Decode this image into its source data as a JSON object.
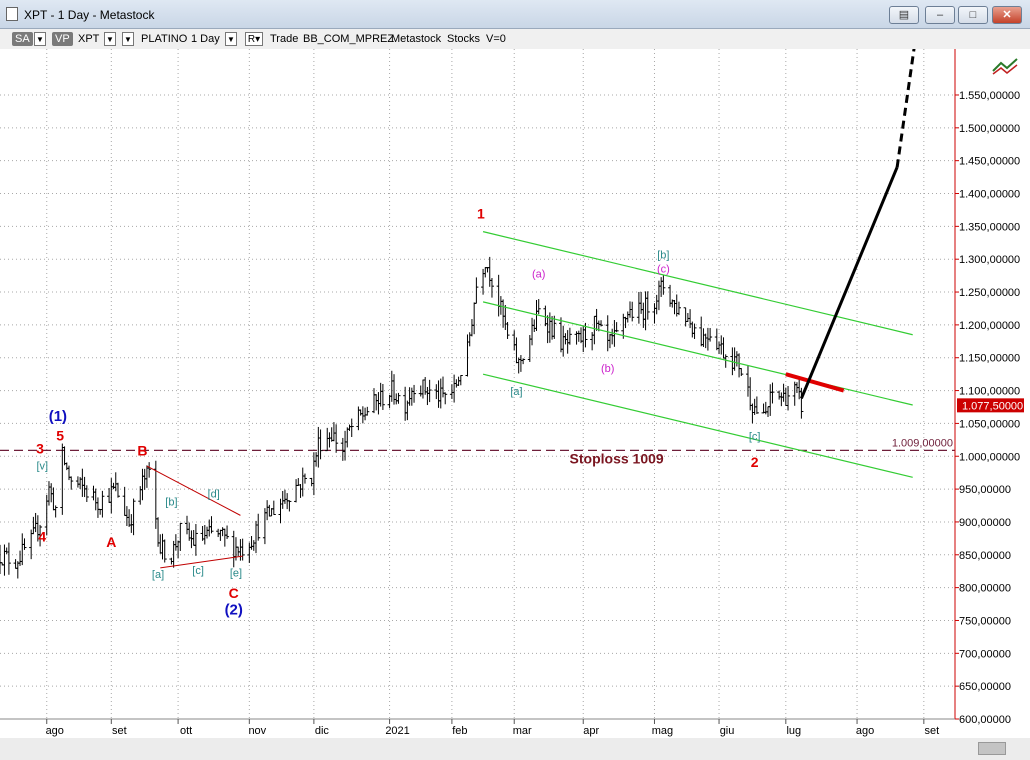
{
  "window": {
    "title": "XPT - 1 Day - Metastock",
    "controls": [
      "restore",
      "minimize",
      "maximize",
      "close"
    ]
  },
  "toolbar": {
    "sa": "SA",
    "vp": "VP",
    "symbol": "XPT",
    "name": "PLATINO",
    "interval": "1 Day",
    "r": "R",
    "mode": "Trade",
    "template": "BB_COM_MPREZ",
    "source": "Metastock",
    "type": "Stocks",
    "volume": "V=0"
  },
  "colors": {
    "background": "#ffffff",
    "grid": "#a8a8a8",
    "price_bars": "#000000",
    "channel": "#33cc33",
    "resistance_segment": "#e00000",
    "stoploss_line": "#6e1f3a",
    "axis_line": "#cc0000",
    "last_price_flag": "#cc0000",
    "wave_red": "#e00000",
    "wave_blue": "#1010c0",
    "wave_teal": "#2a8a8a",
    "wave_magenta": "#cc22cc",
    "triangle": "#c00000"
  },
  "chart_data": {
    "type": "bar",
    "title": "",
    "xlabel": "",
    "ylabel": "",
    "x_domain": [
      "2020-07-13",
      "2021-09-15"
    ],
    "ylim": [
      600,
      1620
    ],
    "yticks": [
      600,
      650,
      700,
      750,
      800,
      850,
      900,
      950,
      1000,
      1050,
      1100,
      1150,
      1200,
      1250,
      1300,
      1350,
      1400,
      1450,
      1500,
      1550
    ],
    "ytick_labels": [
      "600,00000",
      "650,00000",
      "700,00000",
      "750,00000",
      "800,00000",
      "850,00000",
      "900,00000",
      "950,00000",
      "1.000,00000",
      "1.050,00000",
      "1.100,00000",
      "1.150,00000",
      "1.200,00000",
      "1.250,00000",
      "1.300,00000",
      "1.350,00000",
      "1.400,00000",
      "1.450,00000",
      "1.500,00000",
      "1.550,00000"
    ],
    "xticks": [
      {
        "date": "2020-08-03",
        "label": "ago"
      },
      {
        "date": "2020-09-01",
        "label": "set"
      },
      {
        "date": "2020-10-01",
        "label": "ott"
      },
      {
        "date": "2020-11-02",
        "label": "nov"
      },
      {
        "date": "2020-12-01",
        "label": "dic"
      },
      {
        "date": "2021-01-04",
        "label": "2021"
      },
      {
        "date": "2021-02-01",
        "label": "feb"
      },
      {
        "date": "2021-03-01",
        "label": "mar"
      },
      {
        "date": "2021-04-01",
        "label": "apr"
      },
      {
        "date": "2021-05-03",
        "label": "mag"
      },
      {
        "date": "2021-06-01",
        "label": "giu"
      },
      {
        "date": "2021-07-01",
        "label": "lug"
      },
      {
        "date": "2021-08-02",
        "label": "ago"
      },
      {
        "date": "2021-09-01",
        "label": "set"
      }
    ],
    "grid": true,
    "price_path": [
      [
        "2020-07-13",
        850
      ],
      [
        "2020-07-20",
        840
      ],
      [
        "2020-07-27",
        870
      ],
      [
        "2020-07-31",
        900
      ],
      [
        "2020-08-04",
        950
      ],
      [
        "2020-08-07",
        920
      ],
      [
        "2020-08-10",
        1000
      ],
      [
        "2020-08-14",
        960
      ],
      [
        "2020-08-20",
        950
      ],
      [
        "2020-08-26",
        930
      ],
      [
        "2020-09-03",
        950
      ],
      [
        "2020-09-09",
        900
      ],
      [
        "2020-09-15",
        960
      ],
      [
        "2020-09-18",
        975
      ],
      [
        "2020-09-23",
        860
      ],
      [
        "2020-09-28",
        850
      ],
      [
        "2020-10-02",
        885
      ],
      [
        "2020-10-08",
        870
      ],
      [
        "2020-10-14",
        880
      ],
      [
        "2020-10-20",
        880
      ],
      [
        "2020-10-26",
        862
      ],
      [
        "2020-10-30",
        860
      ],
      [
        "2020-11-03",
        875
      ],
      [
        "2020-11-09",
        905
      ],
      [
        "2020-11-16",
        930
      ],
      [
        "2020-11-23",
        955
      ],
      [
        "2020-11-30",
        970
      ],
      [
        "2020-12-03",
        1020
      ],
      [
        "2020-12-09",
        1035
      ],
      [
        "2020-12-14",
        1010
      ],
      [
        "2020-12-17",
        1040
      ],
      [
        "2020-12-22",
        1060
      ],
      [
        "2020-12-28",
        1080
      ],
      [
        "2021-01-05",
        1100
      ],
      [
        "2021-01-11",
        1080
      ],
      [
        "2021-01-15",
        1110
      ],
      [
        "2021-01-21",
        1100
      ],
      [
        "2021-01-27",
        1090
      ],
      [
        "2021-02-02",
        1100
      ],
      [
        "2021-02-08",
        1160
      ],
      [
        "2021-02-12",
        1260
      ],
      [
        "2021-02-16",
        1300
      ],
      [
        "2021-02-19",
        1270
      ],
      [
        "2021-02-24",
        1210
      ],
      [
        "2021-02-26",
        1180
      ],
      [
        "2021-03-03",
        1140
      ],
      [
        "2021-03-08",
        1180
      ],
      [
        "2021-03-12",
        1220
      ],
      [
        "2021-03-17",
        1200
      ],
      [
        "2021-03-23",
        1170
      ],
      [
        "2021-03-30",
        1175
      ],
      [
        "2021-04-06",
        1200
      ],
      [
        "2021-04-12",
        1170
      ],
      [
        "2021-04-16",
        1180
      ],
      [
        "2021-04-21",
        1220
      ],
      [
        "2021-04-27",
        1220
      ],
      [
        "2021-05-03",
        1240
      ],
      [
        "2021-05-07",
        1260
      ],
      [
        "2021-05-12",
        1230
      ],
      [
        "2021-05-18",
        1210
      ],
      [
        "2021-05-24",
        1180
      ],
      [
        "2021-05-28",
        1190
      ],
      [
        "2021-06-03",
        1160
      ],
      [
        "2021-06-10",
        1140
      ],
      [
        "2021-06-16",
        1080
      ],
      [
        "2021-06-21",
        1055
      ],
      [
        "2021-06-25",
        1095
      ],
      [
        "2021-06-30",
        1090
      ],
      [
        "2021-07-05",
        1100
      ],
      [
        "2021-07-08",
        1077.5
      ]
    ],
    "series": [
      {
        "points": [
          [
            "2021-02-15",
            1342
          ],
          [
            "2021-08-27",
            1185
          ]
        ]
      },
      {
        "points": [
          [
            "2021-02-15",
            1235
          ],
          [
            "2021-08-27",
            1078
          ]
        ]
      },
      {
        "points": [
          [
            "2021-02-15",
            1125
          ],
          [
            "2021-08-27",
            968
          ]
        ]
      },
      {
        "points": [
          [
            "2021-07-01",
            1125
          ],
          [
            "2021-07-27",
            1100
          ]
        ]
      },
      {
        "points": [
          [
            "2021-07-08",
            1088
          ],
          [
            "2021-08-20",
            1440
          ],
          [
            "2021-08-28",
            1630
          ]
        ]
      }
    ],
    "horizontal_lines": [
      {
        "value": 1009,
        "label": "1.009,00000",
        "text": "Stoploss 1009"
      }
    ],
    "last_price": {
      "value": 1077.5,
      "label": "1.077,50000"
    },
    "triangle": {
      "upper": [
        [
          "2020-09-17",
          985
        ],
        [
          "2020-10-29",
          910
        ]
      ],
      "lower": [
        [
          "2020-09-23",
          830
        ],
        [
          "2020-10-30",
          848
        ]
      ]
    },
    "annotations": [
      {
        "text": "(1)",
        "date": "2020-08-08",
        "value": 1054,
        "color": "blue"
      },
      {
        "text": "5",
        "date": "2020-08-09",
        "value": 1024,
        "color": "red"
      },
      {
        "text": "3",
        "date": "2020-07-31",
        "value": 1004,
        "color": "red"
      },
      {
        "text": "[v]",
        "date": "2020-08-01",
        "value": 980,
        "color": "teal"
      },
      {
        "text": "4",
        "date": "2020-08-01",
        "value": 870,
        "color": "red"
      },
      {
        "text": "A",
        "date": "2020-09-01",
        "value": 862,
        "color": "red"
      },
      {
        "text": "B",
        "date": "2020-09-15",
        "value": 1001,
        "color": "red"
      },
      {
        "text": "[b]",
        "date": "2020-09-28",
        "value": 925,
        "color": "teal"
      },
      {
        "text": "[d]",
        "date": "2020-10-17",
        "value": 937,
        "color": "teal"
      },
      {
        "text": "[a]",
        "date": "2020-09-22",
        "value": 815,
        "color": "teal"
      },
      {
        "text": "[c]",
        "date": "2020-10-10",
        "value": 821,
        "color": "teal"
      },
      {
        "text": "[e]",
        "date": "2020-10-27",
        "value": 817,
        "color": "teal"
      },
      {
        "text": "C",
        "date": "2020-10-26",
        "value": 784,
        "color": "red"
      },
      {
        "text": "(2)",
        "date": "2020-10-26",
        "value": 759,
        "color": "blue"
      },
      {
        "text": "1",
        "date": "2021-02-14",
        "value": 1362,
        "color": "red"
      },
      {
        "text": "(a)",
        "date": "2021-03-12",
        "value": 1272,
        "color": "magenta"
      },
      {
        "text": "[a]",
        "date": "2021-03-02",
        "value": 1093,
        "color": "teal"
      },
      {
        "text": "(b)",
        "date": "2021-04-12",
        "value": 1128,
        "color": "magenta"
      },
      {
        "text": "[b]",
        "date": "2021-05-07",
        "value": 1301,
        "color": "teal"
      },
      {
        "text": "(c)",
        "date": "2021-05-07",
        "value": 1280,
        "color": "magenta"
      },
      {
        "text": "[c]",
        "date": "2021-06-17",
        "value": 1025,
        "color": "teal"
      },
      {
        "text": "2",
        "date": "2021-06-17",
        "value": 984,
        "color": "red"
      }
    ]
  }
}
